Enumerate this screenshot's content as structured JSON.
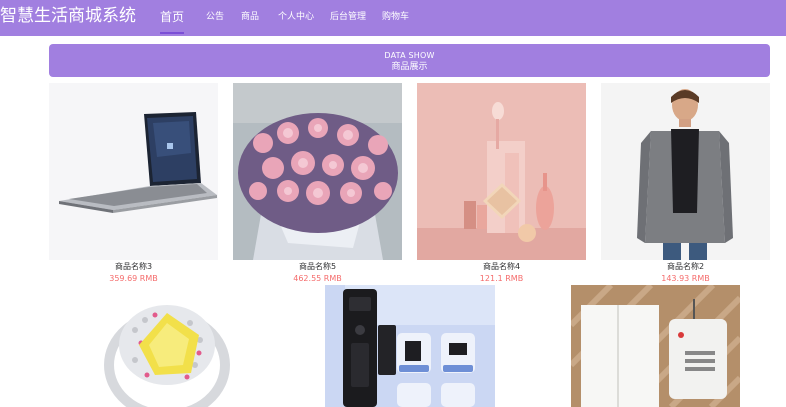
{
  "header": {
    "brand": "智慧生活商城系统",
    "nav": [
      {
        "label": "首页",
        "active": true
      },
      {
        "label": "公告"
      },
      {
        "label": "商品"
      },
      {
        "label": "个人中心"
      },
      {
        "label": "后台管理"
      },
      {
        "label": "购物车"
      }
    ],
    "colors": {
      "bar": "#a17fe0",
      "active_underline": "#7b4fd6"
    }
  },
  "banner": {
    "title_en": "DATA SHOW",
    "title_cn": "商品展示"
  },
  "products": [
    {
      "name": "商品名称3",
      "price": "359.69 RMB",
      "image": "laptop-image"
    },
    {
      "name": "商品名称5",
      "price": "462.55 RMB",
      "image": "rose-bouquet-image"
    },
    {
      "name": "商品名称4",
      "price": "121.1 RMB",
      "image": "cosmetics-image"
    },
    {
      "name": "商品名称2",
      "price": "143.93 RMB",
      "image": "man-jacket-image"
    },
    {
      "name": "",
      "price": "",
      "image": "yellow-gem-ring-image"
    },
    {
      "name": "",
      "price": "",
      "image": "smart-door-lock-image"
    },
    {
      "name": "",
      "price": "",
      "image": "smart-switch-image"
    }
  ],
  "price_color": "#f56c6c"
}
